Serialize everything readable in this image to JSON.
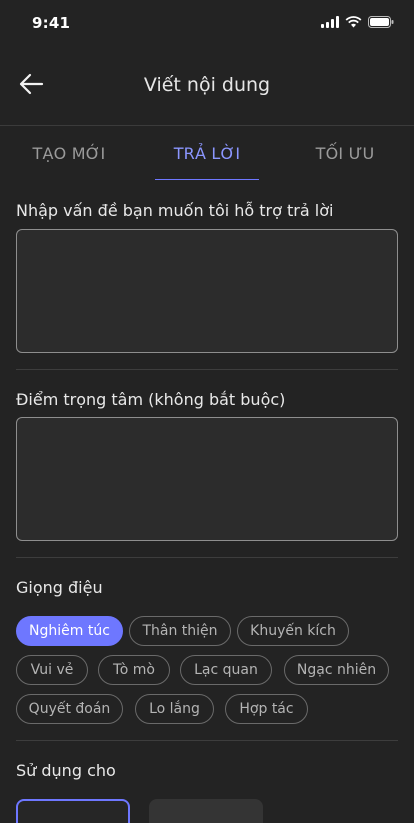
{
  "status": {
    "time": "9:41"
  },
  "header": {
    "title": "Viết nội dung"
  },
  "tabs": [
    {
      "label": "TẠO MỚI",
      "active": false
    },
    {
      "label": "TRẢ LỜI",
      "active": true
    },
    {
      "label": "TỐI ƯU",
      "active": false
    }
  ],
  "form": {
    "question_label": "Nhập vấn đề bạn muốn tôi hỗ trợ trả lời",
    "question_value": "",
    "focus_label": "Điểm trọng tâm (không bắt buộc)",
    "focus_value": ""
  },
  "tone": {
    "label": "Giọng điệu",
    "options": [
      "Nghiêm túc",
      "Thân thiện",
      "Khuyến kích",
      "Vui vẻ",
      "Tò mò",
      "Lạc quan",
      "Ngạc nhiên",
      "Quyết đoán",
      "Lo lắng",
      "Hợp tác"
    ],
    "selected": "Nghiêm túc"
  },
  "usage": {
    "label": "Sử dụng cho"
  },
  "colors": {
    "accent": "#6e77ff",
    "background": "#232323"
  }
}
